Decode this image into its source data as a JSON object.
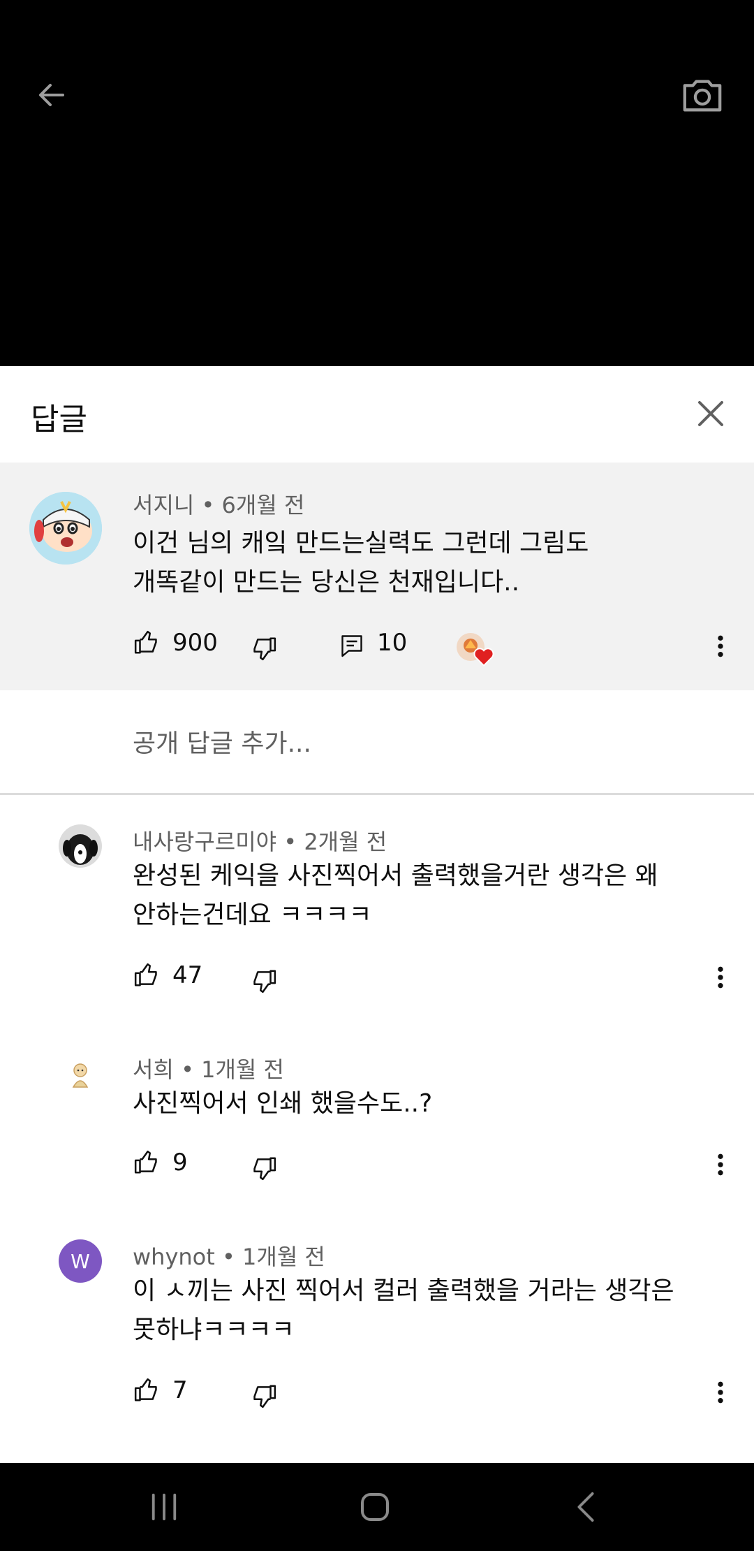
{
  "panel": {
    "title": "답글"
  },
  "parent_comment": {
    "author": "서지니",
    "time": "6개월 전",
    "text_line1": "이건 님의 캐잌 만드는실력도 그런데 그림도",
    "text_line2": "개똑같이 만드는 당신은 천재입니다..",
    "likes": "900",
    "replies": "10"
  },
  "reply_box": {
    "placeholder": "공개 답글 추가..."
  },
  "replies": [
    {
      "author": "내사랑구르미야",
      "time": "2개월 전",
      "text_line1": "완성된 케익을 사진찍어서 출력했을거란 생각은 왜",
      "text_line2": "안하는건데요 ㅋㅋㅋㅋ",
      "likes": "47"
    },
    {
      "author": "서희",
      "time": "1개월 전",
      "text_line1": "사진찍어서 인쇄 했을수도..?",
      "likes": "9"
    },
    {
      "author": "whynot",
      "time": "1개월 전",
      "avatar_letter": "W",
      "text_line1": "이 ㅅ끼는 사진 찍어서 컬러 출력했을 거라는 생각은",
      "text_line2": "못하냐ㅋㅋㅋㅋ",
      "likes": "7"
    }
  ],
  "separator": "•",
  "colors": {
    "avatar_w": "#7e57c2",
    "heart": "#e02020",
    "panel_bg": "#f2f2f2"
  }
}
